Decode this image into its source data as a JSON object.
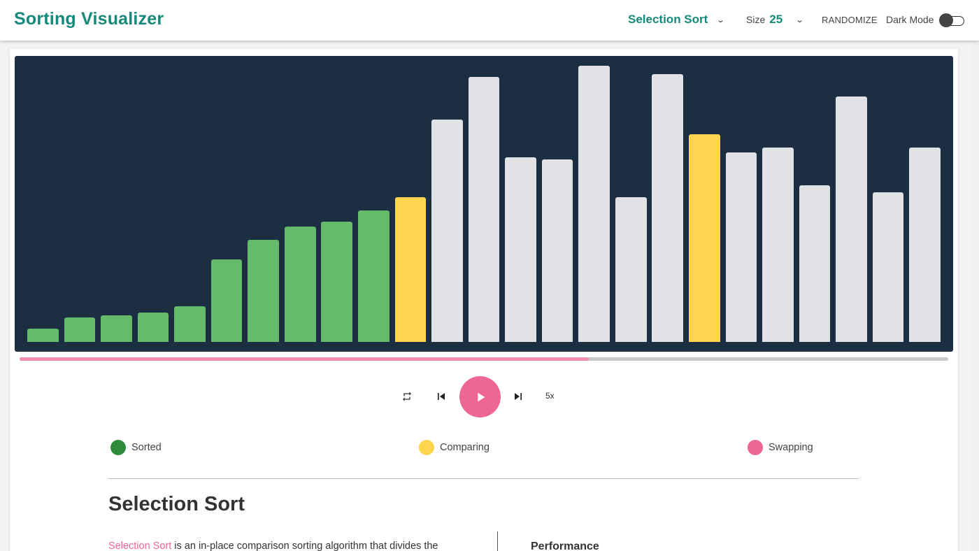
{
  "header": {
    "title": "Sorting Visualizer",
    "algorithm": "Selection Sort",
    "size_label": "Size",
    "size_value": "25",
    "randomize_label": "RANDOMIZE",
    "dark_mode_label": "Dark Mode",
    "dark_mode_on": false
  },
  "visualizer": {
    "bars": [
      {
        "value": 19,
        "state": "sorted"
      },
      {
        "value": 35,
        "state": "sorted"
      },
      {
        "value": 38,
        "state": "sorted"
      },
      {
        "value": 42,
        "state": "sorted"
      },
      {
        "value": 51,
        "state": "sorted"
      },
      {
        "value": 118,
        "state": "sorted"
      },
      {
        "value": 146,
        "state": "sorted"
      },
      {
        "value": 165,
        "state": "sorted"
      },
      {
        "value": 172,
        "state": "sorted"
      },
      {
        "value": 188,
        "state": "sorted"
      },
      {
        "value": 207,
        "state": "comparing"
      },
      {
        "value": 318,
        "state": "default"
      },
      {
        "value": 379,
        "state": "default"
      },
      {
        "value": 264,
        "state": "default"
      },
      {
        "value": 261,
        "state": "default"
      },
      {
        "value": 395,
        "state": "default"
      },
      {
        "value": 207,
        "state": "default"
      },
      {
        "value": 383,
        "state": "default"
      },
      {
        "value": 297,
        "state": "comparing"
      },
      {
        "value": 271,
        "state": "default"
      },
      {
        "value": 278,
        "state": "default"
      },
      {
        "value": 224,
        "state": "default"
      },
      {
        "value": 351,
        "state": "default"
      },
      {
        "value": 214,
        "state": "default"
      },
      {
        "value": 278,
        "state": "default"
      }
    ],
    "colors": {
      "sorted": "#66bb6a",
      "comparing": "#ffd54f",
      "default": "#e0e2e5",
      "swapping": "#ee6693",
      "background": "#1b2e42"
    }
  },
  "progress": {
    "fraction": 0.613
  },
  "controls": {
    "repeat_icon": "repeat-icon",
    "prev_icon": "skip-previous-icon",
    "play_icon": "play-icon",
    "next_icon": "skip-next-icon",
    "speed_label": "5x"
  },
  "legend": {
    "sorted": {
      "label": "Sorted",
      "color": "#2e8b3e"
    },
    "comparing": {
      "label": "Comparing",
      "color": "#ffd54f"
    },
    "swapping": {
      "label": "Swapping",
      "color": "#ee6693"
    }
  },
  "description": {
    "title": "Selection Sort",
    "link_text": "Selection Sort",
    "text": " is an in-place comparison sorting algorithm that divides the",
    "performance_title": "Performance"
  }
}
